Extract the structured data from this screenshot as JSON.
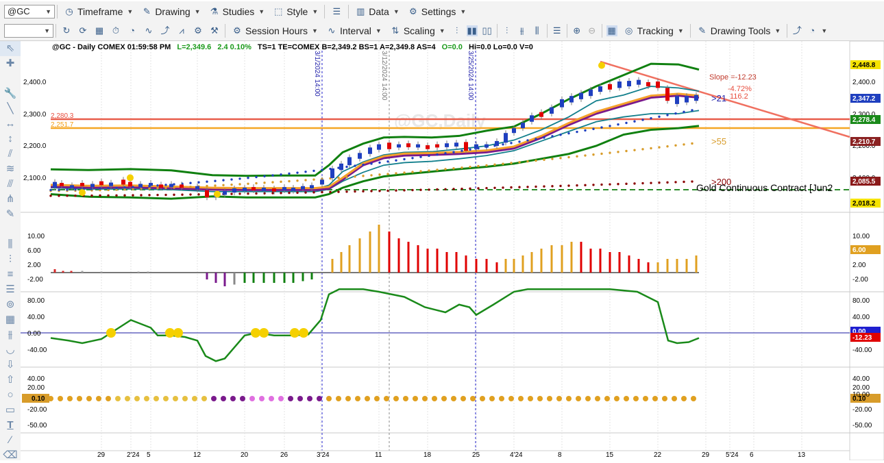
{
  "toolbar1": {
    "symbol": "@GC",
    "timeframe": "Timeframe",
    "drawing": "Drawing",
    "studies": "Studies",
    "style": "Style",
    "data": "Data",
    "settings": "Settings"
  },
  "toolbar2": {
    "session_hours": "Session Hours",
    "interval": "Interval",
    "scaling": "Scaling",
    "tracking": "Tracking",
    "drawing_tools": "Drawing Tools"
  },
  "chart": {
    "header": "@GC - Daily  COMEX  01:59:58 PM",
    "hdr_L": "L=2,349.6",
    "hdr_chg": "2.4  0.10%",
    "hdr_rest": "TS=1  TE=COMEX  B=2,349.2  BS=1  A=2,349.8  AS=4",
    "hdr_O": "O=0.0",
    "hdr_tail": "Hi=0.0  Lo=0.0  V=0",
    "watermark": "@GC,Daily",
    "slope_label": "Slope =-12.23",
    "pct_label": "-4.72%",
    "pts_label": "116.2",
    "ma21_label": ">21",
    "ma55_label": ">55",
    "ma200_label": ">200",
    "contract_label": "Gold Continuous Contract [Jun2",
    "hline_red_label": "2,280.3",
    "hline_orange_label": "2,251.7",
    "vlines": [
      "3/1/2024 14:00",
      "3/12/2024 14:00",
      "3/25/2024 14:00"
    ],
    "price_axis": [
      "2,400.0",
      "2,300.0",
      "2,200.0",
      "2,100.0"
    ],
    "badges": {
      "top": "2,448.8",
      "last": "2,347.2",
      "ema": "2,278.4",
      "ma55": "2,210.7",
      "ma200": "2,085.5",
      "low": "2,018.2",
      "hist": "6.00",
      "osc_blue": "0.00",
      "osc_red": "-12.23",
      "dots": "0.10"
    },
    "hist_axis": [
      "10.00",
      "6.00",
      "2.00",
      "-2.00"
    ],
    "osc_axis": [
      "80.00",
      "40.00",
      "0.00",
      "-40.00"
    ],
    "dot_axis": [
      "40.00",
      "20.00",
      "10.00",
      "-20.00",
      "-50.00"
    ],
    "dot_axis_right": [
      "40.00",
      "20.00",
      "10.00",
      "-20.00",
      "-50.00"
    ],
    "time_axis": [
      "29",
      "2'24",
      "5",
      "12",
      "20",
      "26",
      "3'24",
      "11",
      "18",
      "25",
      "4'24",
      "8",
      "15",
      "22",
      "29",
      "5'24",
      "6",
      "13"
    ],
    "colors": {
      "bull": "#1f3fbf",
      "bear": "#e00000",
      "green": "#108010",
      "teal": "#127f8c",
      "orange": "#f5a12a",
      "purple": "#7a1a8c",
      "gold": "#d89c2a",
      "maroon": "#8b0000"
    }
  }
}
